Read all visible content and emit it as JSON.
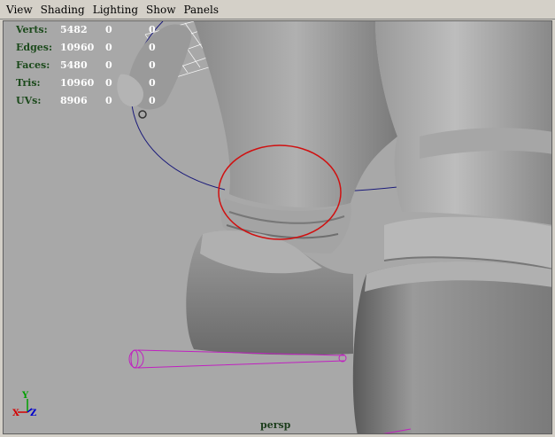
{
  "menu": {
    "items": [
      "View",
      "Shading",
      "Lighting",
      "Show",
      "Panels"
    ]
  },
  "hud": {
    "rows": [
      {
        "label": "Verts:",
        "v1": "5482",
        "v2": "0",
        "v3": "0"
      },
      {
        "label": "Edges:",
        "v1": "10960",
        "v2": "0",
        "v3": "0"
      },
      {
        "label": "Faces:",
        "v1": "5480",
        "v2": "0",
        "v3": "0"
      },
      {
        "label": "Tris:",
        "v1": "10960",
        "v2": "0",
        "v3": "0"
      },
      {
        "label": "UVs:",
        "v1": "8906",
        "v2": "0",
        "v3": "0"
      }
    ]
  },
  "camera": {
    "name": "persp"
  },
  "axis": {
    "x": "X",
    "y": "Y",
    "z": "Z"
  },
  "colors": {
    "viewport_bg": "#a8a8a8",
    "highlight_circle": "#d01010",
    "nurbs_curve": "#1a1a7a",
    "joint_color": "#c020c0",
    "hud_label": "#1c4a1c"
  }
}
